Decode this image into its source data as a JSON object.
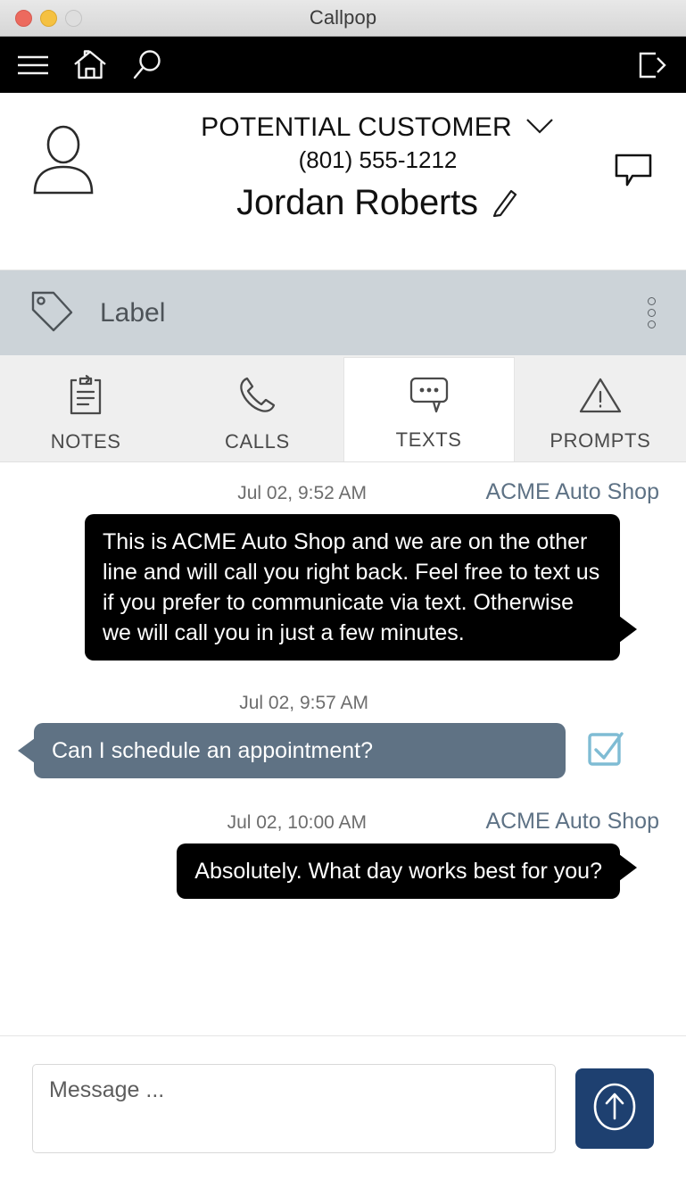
{
  "window": {
    "title": "Callpop",
    "traffic_lights": [
      "close",
      "minimize",
      "zoom"
    ]
  },
  "toolbar": {
    "menu_icon": "hamburger-menu-icon",
    "home_icon": "home-icon",
    "search_icon": "search-icon",
    "logout_icon": "logout-icon"
  },
  "contact": {
    "avatar_icon": "person-avatar-icon",
    "type": "POTENTIAL CUSTOMER",
    "type_chevron_icon": "chevron-down-icon",
    "phone": "(801) 555-1212",
    "name": "Jordan Roberts",
    "edit_icon": "pencil-edit-icon",
    "chat_icon": "speech-bubble-icon"
  },
  "label_bar": {
    "tag_icon": "tag-icon",
    "text": "Label",
    "menu_icon": "kebab-menu-icon",
    "background": "#ccd3d8"
  },
  "tabs": [
    {
      "label": "NOTES",
      "icon": "clipboard-icon",
      "active": false
    },
    {
      "label": "CALLS",
      "icon": "phone-icon",
      "active": false
    },
    {
      "label": "TEXTS",
      "icon": "chat-dots-icon",
      "active": true
    },
    {
      "label": "PROMPTS",
      "icon": "warning-triangle-icon",
      "active": false
    }
  ],
  "thread": {
    "messages": [
      {
        "direction": "outgoing",
        "timestamp": "Jul 02, 9:52 AM",
        "sender": "ACME Auto Shop",
        "text": "This is ACME Auto Shop and we are on the other line and will call you right back. Feel free to text us if you prefer to communicate via text. Otherwise we will call you in just a few minutes."
      },
      {
        "direction": "incoming",
        "timestamp": "Jul 02, 9:57 AM",
        "sender": "",
        "text": "Can I schedule an appointment?",
        "status_icon": "checkbox-checked-icon"
      },
      {
        "direction": "outgoing",
        "timestamp": "Jul 02, 10:00 AM",
        "sender": "ACME Auto Shop",
        "text": "Absolutely. What day works best for you?"
      }
    ]
  },
  "composer": {
    "placeholder": "Message ...",
    "value": "",
    "send_icon": "arrow-up-circle-icon"
  },
  "colors": {
    "toolbar_bg": "#000000",
    "outgoing_bubble": "#000000",
    "incoming_bubble": "#5f7284",
    "sender_text": "#5e7285",
    "label_bar": "#ccd3d8",
    "send_button": "#1e4070",
    "check_icon": "#7fbcd4",
    "tab_bar": "#efefef"
  }
}
